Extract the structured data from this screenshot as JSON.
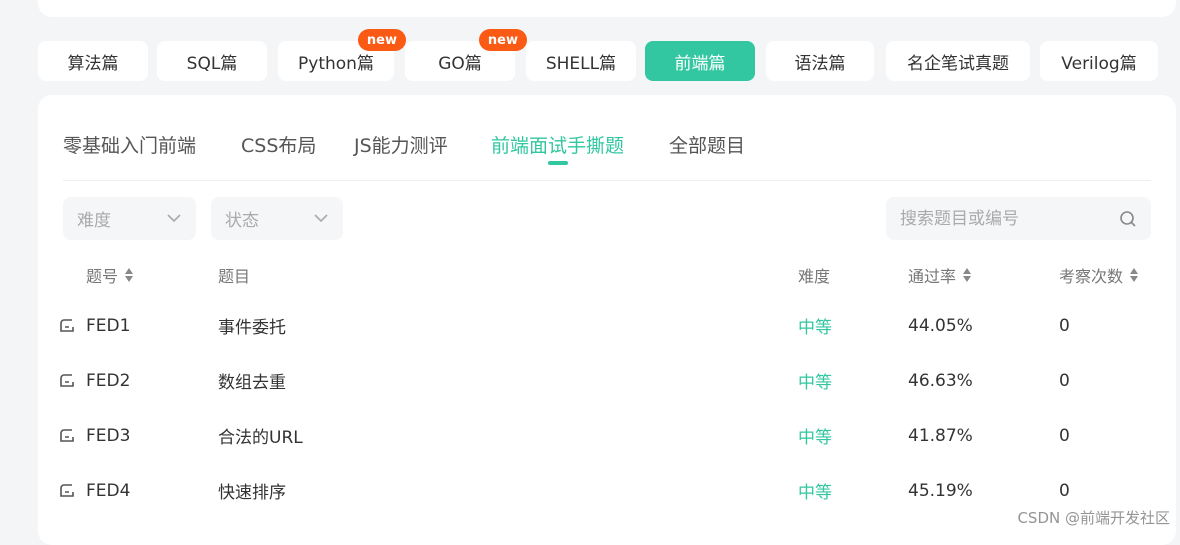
{
  "categories": [
    {
      "label": "算法篇",
      "badge": ""
    },
    {
      "label": "SQL篇",
      "badge": ""
    },
    {
      "label": "Python篇",
      "badge": "new"
    },
    {
      "label": "GO篇",
      "badge": "new"
    },
    {
      "label": "SHELL篇",
      "badge": ""
    },
    {
      "label": "前端篇",
      "badge": ""
    },
    {
      "label": "语法篇",
      "badge": ""
    },
    {
      "label": "名企笔试真题",
      "badge": ""
    },
    {
      "label": "Verilog篇",
      "badge": ""
    }
  ],
  "active_category": "前端篇",
  "subtabs": [
    "零基础入门前端",
    "CSS布局",
    "JS能力测评",
    "前端面试手撕题",
    "全部题目"
  ],
  "active_subtab": "前端面试手撕题",
  "filters": {
    "difficulty": "难度",
    "status": "状态"
  },
  "search": {
    "placeholder": "搜索题目或编号",
    "value": ""
  },
  "table": {
    "headers": {
      "id": "题号",
      "title": "题目",
      "difficulty": "难度",
      "pass_rate": "通过率",
      "count": "考察次数"
    },
    "rows": [
      {
        "id": "FED1",
        "title": "事件委托",
        "difficulty": "中等",
        "pass_rate": "44.05%",
        "count": "0"
      },
      {
        "id": "FED2",
        "title": "数组去重",
        "difficulty": "中等",
        "pass_rate": "46.63%",
        "count": "0"
      },
      {
        "id": "FED3",
        "title": "合法的URL",
        "difficulty": "中等",
        "pass_rate": "41.87%",
        "count": "0"
      },
      {
        "id": "FED4",
        "title": "快速排序",
        "difficulty": "中等",
        "pass_rate": "45.19%",
        "count": "0"
      }
    ]
  },
  "watermark": "CSDN @前端开发社区",
  "colors": {
    "accent": "#32c7a0",
    "badge": "#fa5a14"
  }
}
